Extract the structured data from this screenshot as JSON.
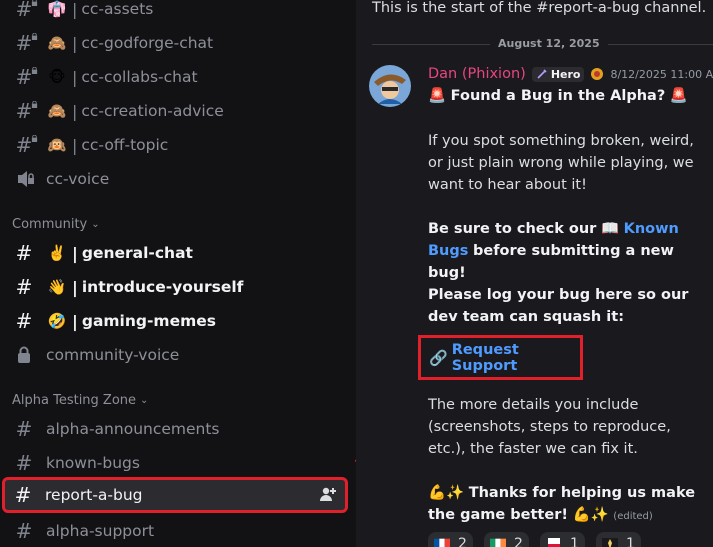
{
  "sidebar": {
    "channels_top": [
      {
        "emoji": "👘",
        "name": "cc-assets"
      },
      {
        "emoji": "🙈",
        "name": "cc-godforge-chat"
      },
      {
        "emoji": "🐵",
        "name": "cc-collabs-chat"
      },
      {
        "emoji": "🙈",
        "name": "cc-creation-advice"
      },
      {
        "emoji": "🙉",
        "name": "cc-off-topic"
      }
    ],
    "voice_channel": "cc-voice",
    "category_community": "Community",
    "community_channels": [
      {
        "emoji": "✌️",
        "name": "general-chat"
      },
      {
        "emoji": "👋",
        "name": "introduce-yourself"
      },
      {
        "emoji": "🤣",
        "name": "gaming-memes"
      }
    ],
    "community_voice": "community-voice",
    "category_alpha": "Alpha Testing Zone",
    "alpha_channels": [
      "alpha-announcements",
      "known-bugs",
      "report-a-bug",
      "alpha-support"
    ],
    "separator": "|"
  },
  "chat": {
    "channel_start": "This is the start of the #report-a-bug channel.",
    "date_divider": "August 12, 2025",
    "message": {
      "author": "Dan (Phixion)",
      "author_color": "#e8467c",
      "role_badge": "Hero",
      "timestamp": "8/12/2025 11:00 AM",
      "title_emoji": "🚨",
      "title": "Found a Bug in the Alpha?",
      "para1": "If you spot something broken, weird, or just plain wrong while playing, we want to hear about it!",
      "para2_bold": "Be sure to check our",
      "para2_book": "📖",
      "para2_link": "Known Bugs",
      "para2_rest": "before submitting a new bug!",
      "para3": "Please log your bug here so our dev team can squash it:",
      "link_icon": "🔗",
      "link_label": "Request Support",
      "para4": "The more details you include (screenshots, steps to reproduce, etc.), the faster we can fix it.",
      "closing_emoji": "💪✨",
      "closing": "Thanks for helping us make the game better!",
      "edited": "(edited)"
    },
    "reactions": [
      {
        "flag": "fr",
        "count": "2"
      },
      {
        "flag": "ie",
        "count": "2"
      },
      {
        "flag": "pl",
        "count": "1"
      },
      {
        "flag": "other",
        "count": "1"
      }
    ]
  },
  "colors": {
    "highlight_box": "#e0202a",
    "link": "#4f9bff",
    "sidebar_bg": "#121214",
    "chat_bg": "#1a1a1e"
  }
}
